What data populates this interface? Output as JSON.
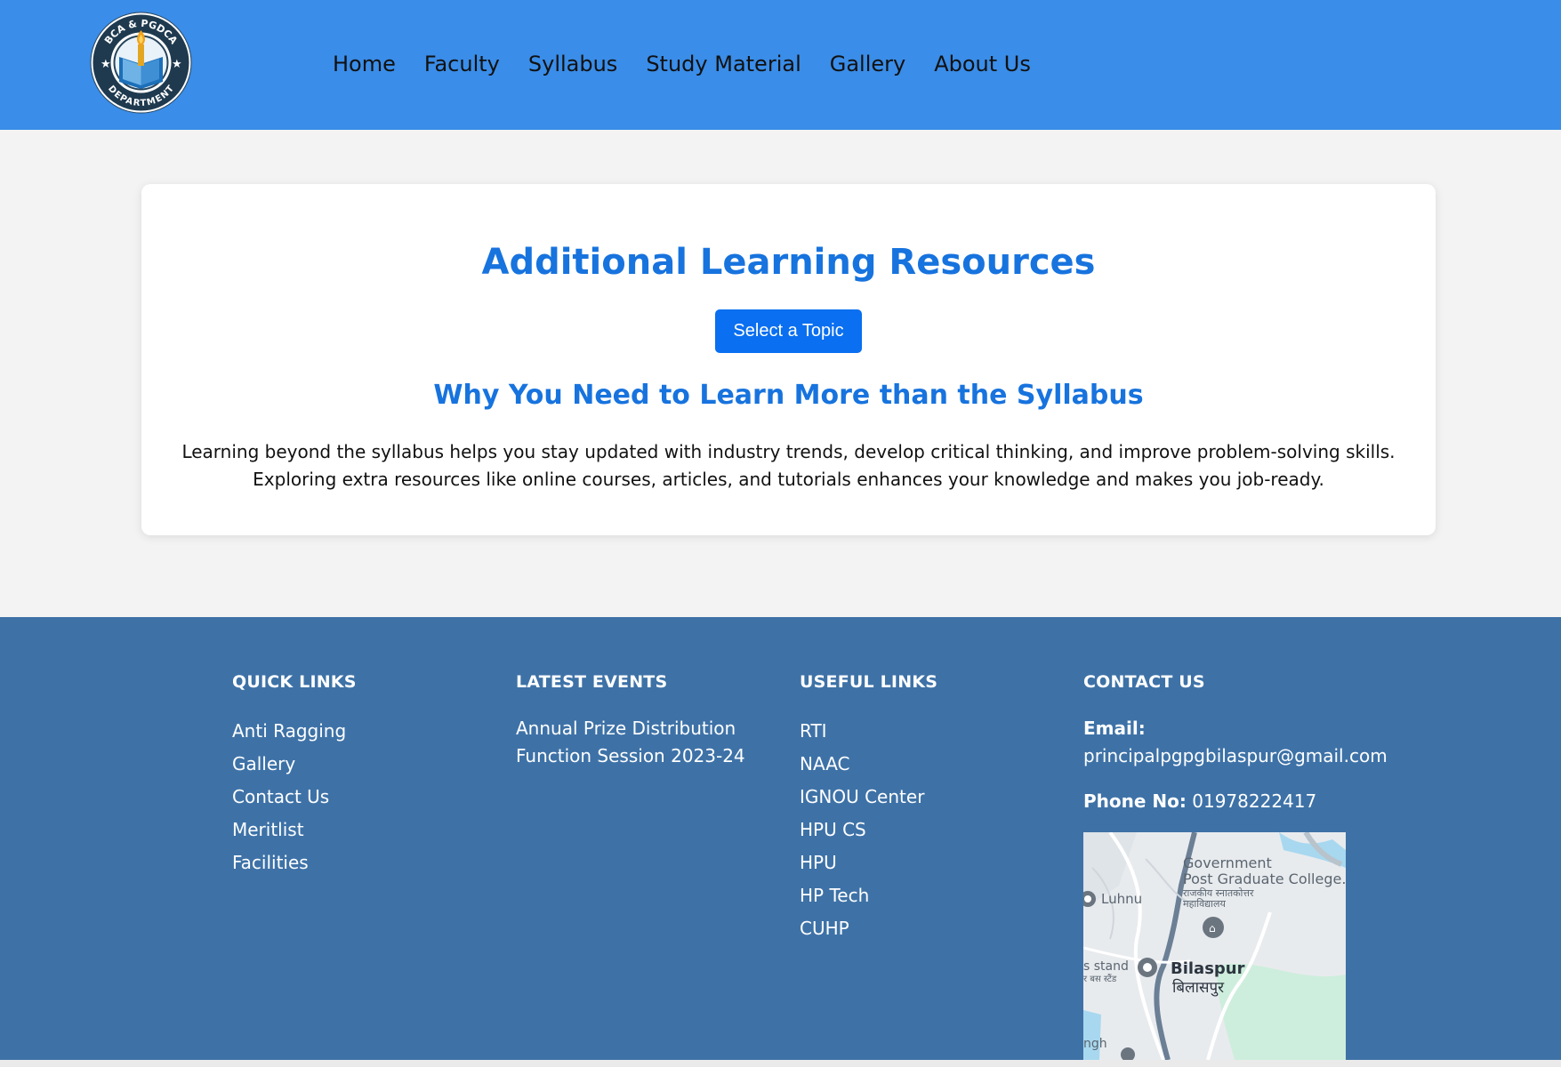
{
  "header": {
    "logo_text_top": "BCA & PGDCA",
    "logo_text_bottom": "DEPARTMENT",
    "nav": [
      "Home",
      "Faculty",
      "Syllabus",
      "Study Material",
      "Gallery",
      "About Us"
    ]
  },
  "main": {
    "title": "Additional Learning Resources",
    "select_button": "Select a Topic",
    "subtitle": "Why You Need to Learn More than the Syllabus",
    "body_line1": "Learning beyond the syllabus helps you stay updated with industry trends, develop critical thinking, and improve problem-solving skills.",
    "body_line2": "Exploring extra resources like online courses, articles, and tutorials enhances your knowledge and makes you job-ready."
  },
  "footer": {
    "quick_links": {
      "heading": "QUICK LINKS",
      "items": [
        "Anti Ragging",
        "Gallery",
        "Contact Us",
        "Meritlist",
        "Facilities"
      ]
    },
    "latest_events": {
      "heading": "LATEST EVENTS",
      "items": [
        "Annual Prize Distribution Function Session 2023-24"
      ]
    },
    "useful_links": {
      "heading": "USEFUL LINKS",
      "items": [
        "RTI",
        "NAAC",
        "IGNOU Center",
        "HPU CS",
        "HPU",
        "HP Tech",
        "CUHP"
      ]
    },
    "contact": {
      "heading": "CONTACT US",
      "email_label": "Email:",
      "email": "principalpgpgbilaspur@gmail.com",
      "phone_label": "Phone No:",
      "phone": "01978222417"
    },
    "map": {
      "place1_line1": "Government",
      "place1_line2": "Post Graduate College.",
      "place1_hindi1": "राजकीय स्नातकोत्तर",
      "place1_hindi2": "महाविद्यालय",
      "luhnu": "Luhnu",
      "city": "Bilaspur",
      "city_hindi": "बिलासपुर",
      "stand": "s stand",
      "stand_hindi": "र बस स्टैंड",
      "bottom_fragment": "ngh"
    }
  },
  "colors": {
    "header_bg": "#3a8de8",
    "accent": "#1773de",
    "button": "#0a6ff0",
    "footer_bg": "#3e72a7"
  }
}
